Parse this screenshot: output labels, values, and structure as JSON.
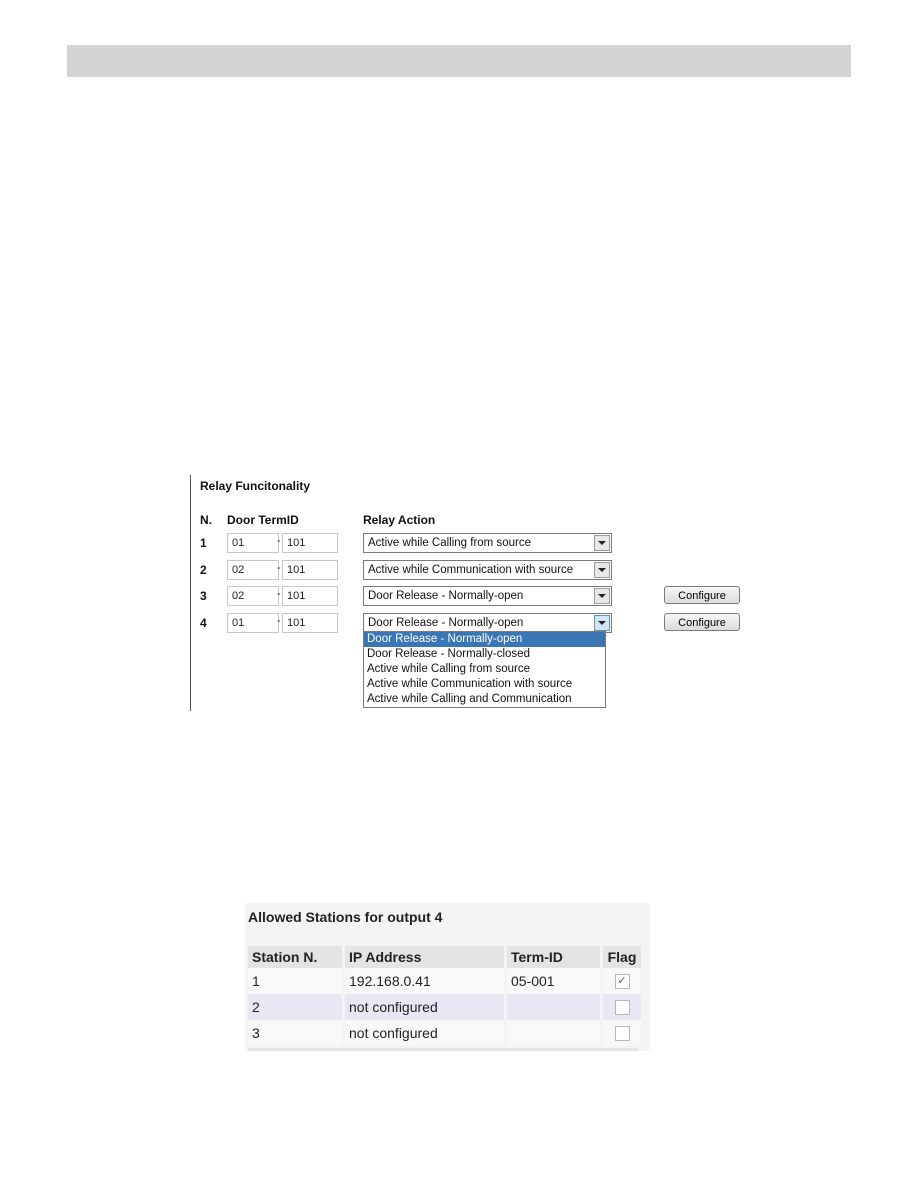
{
  "relay": {
    "title": "Relay Funcitonality",
    "headers": {
      "n": "N.",
      "door_termid": "Door TermID",
      "relay_action": "Relay Action"
    },
    "rows": [
      {
        "n": "1",
        "door": "01",
        "term": "101",
        "dash": "-",
        "action": "Active while Calling from source",
        "configure": null
      },
      {
        "n": "2",
        "door": "02",
        "term": "101",
        "dash": "-",
        "action": "Active while Communication with source",
        "configure": null
      },
      {
        "n": "3",
        "door": "02",
        "term": "101",
        "dash": "-",
        "action": "Door Release - Normally-open",
        "configure": "Configure"
      },
      {
        "n": "4",
        "door": "01",
        "term": "101",
        "dash": "-",
        "action": "Door Release - Normally-open",
        "configure": "Configure"
      }
    ],
    "dropdown_options": [
      "Door Release - Normally-open",
      "Door Release - Normally-closed",
      "Active while Calling from source",
      "Active while Communication with source",
      "Active while Calling and Communication"
    ],
    "dropdown_selected_index": 0
  },
  "stations": {
    "title": "Allowed Stations for output 4",
    "headers": {
      "station": "Station N.",
      "ip": "IP Address",
      "termid": "Term-ID",
      "flag": "Flag"
    },
    "rows": [
      {
        "station": "1",
        "ip": "192.168.0.41",
        "termid": "05-001",
        "flag": true
      },
      {
        "station": "2",
        "ip": "not configured",
        "termid": "",
        "flag": false
      },
      {
        "station": "3",
        "ip": "not configured",
        "termid": "",
        "flag": false
      }
    ]
  },
  "icons": {
    "dropdown_arrow": "▾",
    "check": "✓"
  },
  "colors": {
    "header_bar": "#d2d3d4",
    "selection": "#3a76b6",
    "alt_row": "#e8e8f5"
  }
}
